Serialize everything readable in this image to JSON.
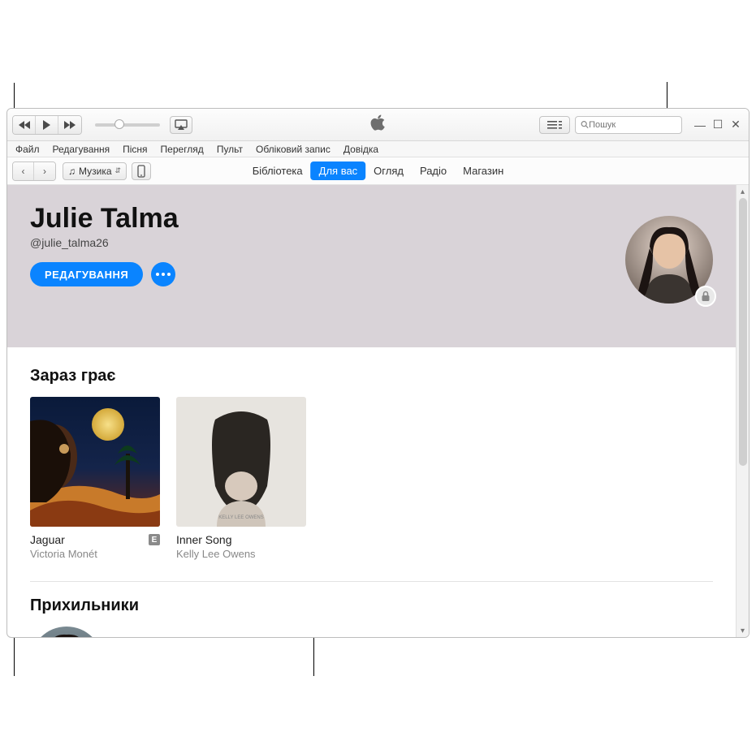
{
  "search": {
    "placeholder": "Пошук"
  },
  "menu": [
    "Файл",
    "Редагування",
    "Пісня",
    "Перегляд",
    "Пульт",
    "Обліковий запис",
    "Довідка"
  ],
  "mediaSelect": {
    "label": "Музика"
  },
  "tabs": [
    {
      "label": "Бібліотека",
      "active": false
    },
    {
      "label": "Для вас",
      "active": true
    },
    {
      "label": "Огляд",
      "active": false
    },
    {
      "label": "Радіо",
      "active": false
    },
    {
      "label": "Магазин",
      "active": false
    }
  ],
  "profile": {
    "name": "Julie Talma",
    "handle": "@julie_talma26",
    "editLabel": "РЕДАГУВАННЯ"
  },
  "sections": {
    "nowPlaying": "Зараз грає",
    "followers": "Прихильники"
  },
  "albums": [
    {
      "title": "Jaguar",
      "artist": "Victoria Monét",
      "explicit": true
    },
    {
      "title": "Inner Song",
      "artist": "Kelly Lee Owens",
      "explicit": false
    }
  ]
}
